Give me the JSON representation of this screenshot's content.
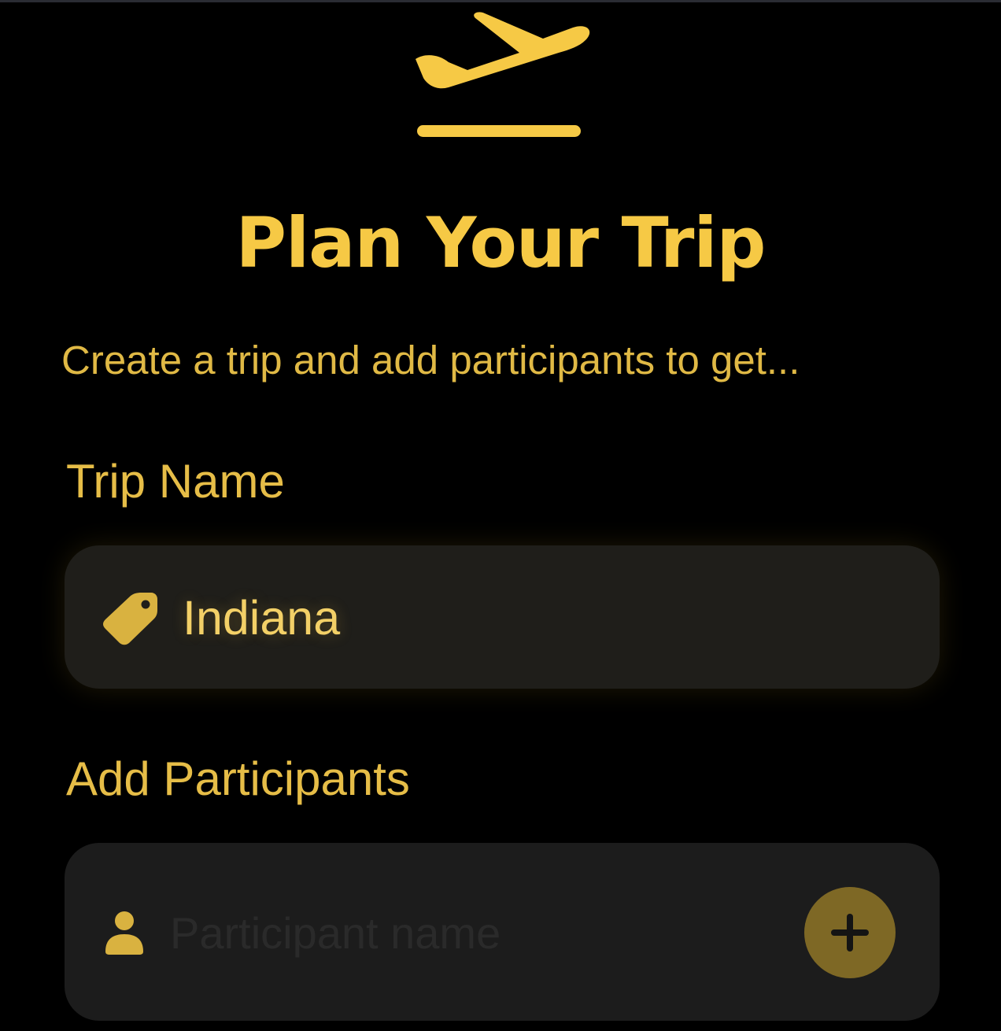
{
  "header": {
    "icon": "airplane-takeoff-icon",
    "title": "Plan Your Trip",
    "subtitle": "Create a trip and add participants to get..."
  },
  "trip_name": {
    "label": "Trip Name",
    "icon": "tag-icon",
    "value": "Indiana"
  },
  "participants": {
    "label": "Add Participants",
    "icon": "person-icon",
    "placeholder": "Participant name",
    "value": "",
    "add_button_icon": "plus-icon"
  },
  "colors": {
    "background": "#000000",
    "accent": "#f6c945",
    "field_background": "#1c1c1c",
    "add_button": "#7e6825"
  }
}
